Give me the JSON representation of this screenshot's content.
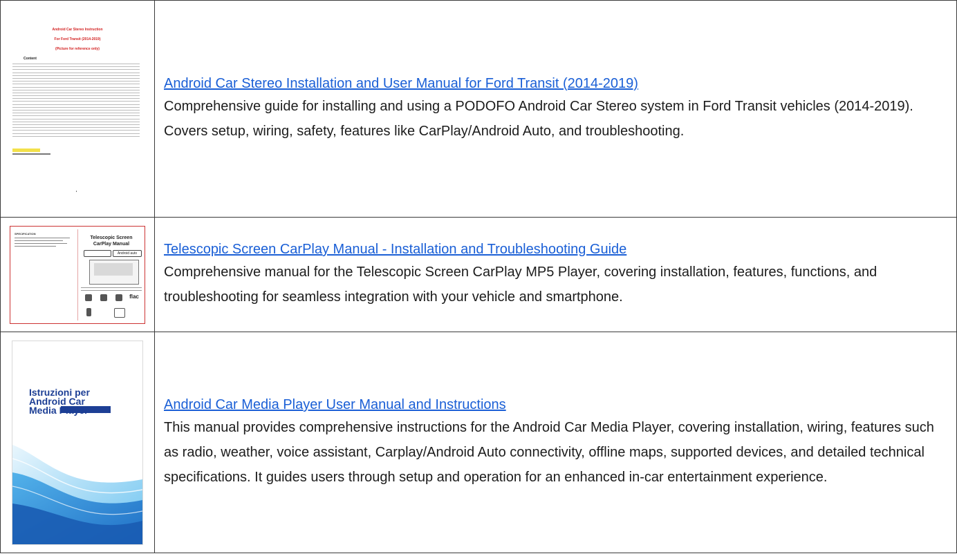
{
  "results": [
    {
      "title": "Android Car Stereo Installation and User Manual for Ford Transit (2014-2019)",
      "description": "Comprehensive guide for installing and using a PODOFO Android Car Stereo system in Ford Transit vehicles (2014-2019). Covers setup, wiring, safety, features like CarPlay/Android Auto, and troubleshooting.",
      "thumbnail": {
        "heading1": "Android Car Stereo Instruction",
        "heading2": "For Ford Transit (2014-2019)",
        "heading3": "(Picture for reference only)",
        "contents_label": "Content"
      }
    },
    {
      "title": "Telescopic Screen CarPlay Manual - Installation and Troubleshooting Guide",
      "description": "Comprehensive manual for the Telescopic Screen CarPlay MP5 Player, covering installation, features, functions, and troubleshooting for seamless integration with your vehicle and smartphone.",
      "thumbnail": {
        "spec_label": "SPECIFICATION",
        "cover_title_line1": "Telescopic Screen",
        "cover_title_line2": "CarPlay Manual",
        "badge_android": "Android auto",
        "badge_flac": "flac"
      }
    },
    {
      "title": "Android Car Media Player User Manual and Instructions",
      "description": "This manual provides comprehensive instructions for the Android Car Media Player, covering installation, wiring, features such as radio, weather, voice assistant, Carplay/Android Auto connectivity, offline maps, supported devices, and detailed technical specifications. It guides users through setup and operation for an enhanced in-car entertainment experience.",
      "thumbnail": {
        "cover_title": "Istruzioni per\nAndroid Car\nMedia Player"
      }
    }
  ],
  "colors": {
    "link": "#1a5fd6",
    "border": "#3a3a3a",
    "thumb1_heading": "#d21f1f",
    "thumb3_title": "#1d3f95",
    "thumb3_wave_light": "#6cc3f0",
    "thumb3_wave_dark": "#1f6fc6"
  }
}
